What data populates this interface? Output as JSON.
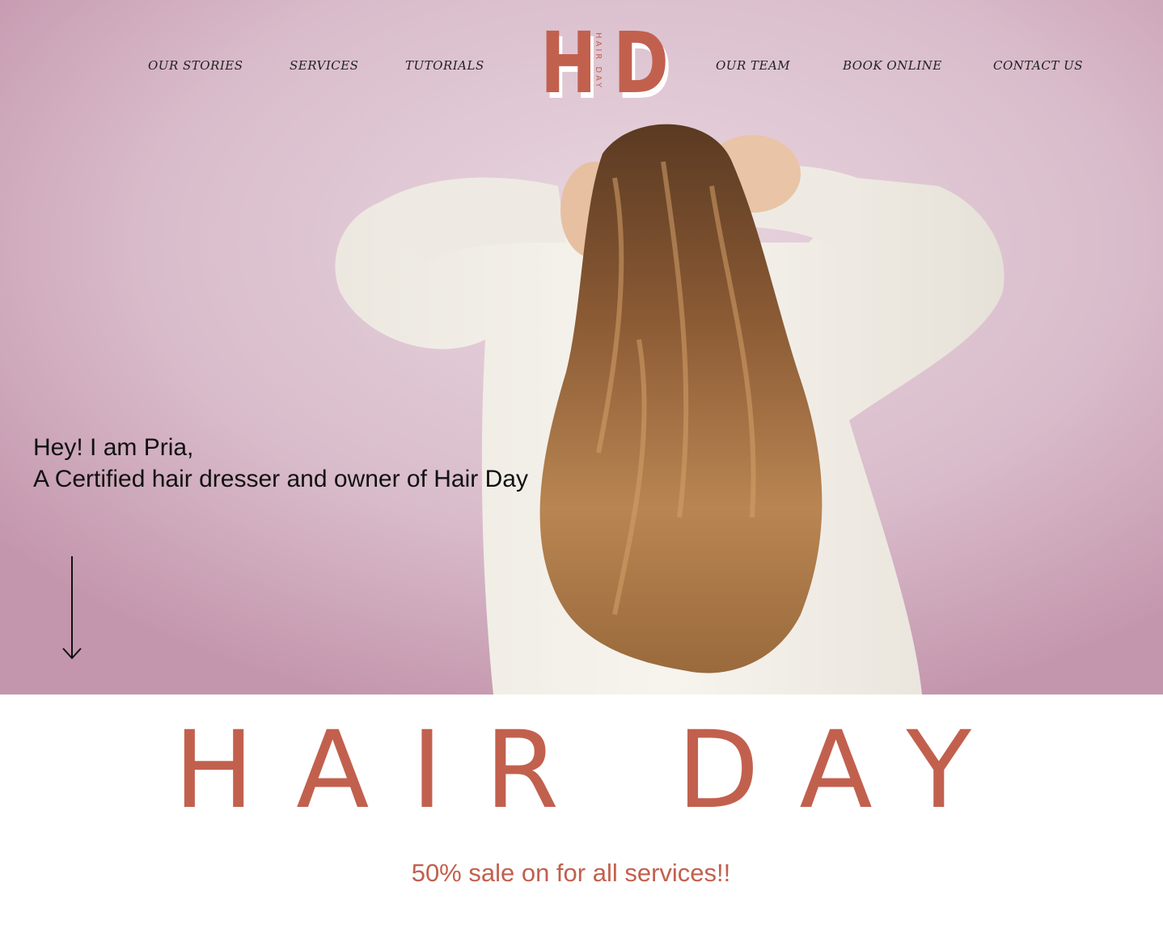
{
  "nav": {
    "left": [
      {
        "label": "OUR STORIES"
      },
      {
        "label": "SERVICES"
      },
      {
        "label": "TUTORIALS"
      }
    ],
    "right": [
      {
        "label": "OUR TEAM"
      },
      {
        "label": "BOOK ONLINE"
      },
      {
        "label": "CONTACT US"
      }
    ]
  },
  "logo": {
    "letter_left": "H",
    "letter_right": "D",
    "subtitle": "HAIR DAY"
  },
  "hero": {
    "intro_line1": "Hey! I am Pria,",
    "intro_line2": "A Certified hair dresser and owner of Hair Day",
    "scroll_icon": "arrow-down-icon"
  },
  "brand": {
    "title": "HAIR DAY",
    "sale": "50% sale on for all services!!"
  },
  "colors": {
    "accent": "#c2604e",
    "hero_bg": "#d7b9c8",
    "text": "#111111"
  }
}
